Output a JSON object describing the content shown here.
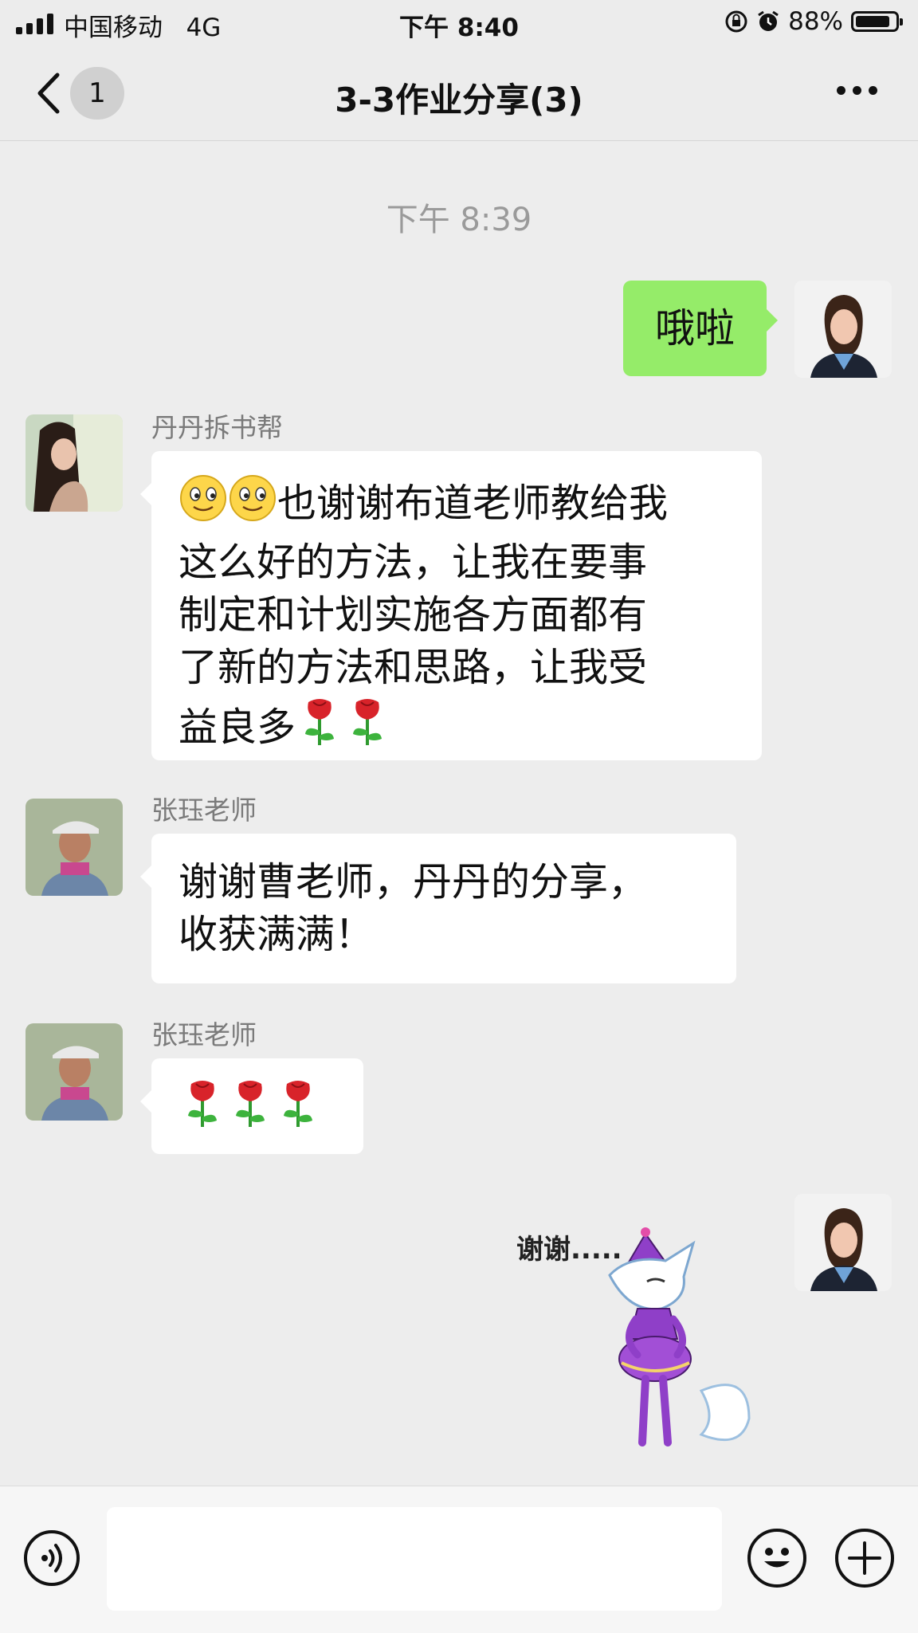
{
  "status_bar": {
    "carrier": "中国移动",
    "network": "4G",
    "time": "下午 8:40",
    "battery_text": "88%",
    "battery_level": 0.88
  },
  "nav": {
    "back_badge": "1",
    "title": "3-3作业分享(3)"
  },
  "chat": {
    "timestamp": "下午 8:39",
    "messages": [
      {
        "sender": "me",
        "text": "哦啦"
      },
      {
        "sender": "丹丹拆书帮",
        "lines": [
          "也谢谢布道老师教给我",
          "这么好的方法，让我在要事",
          "制定和计划实施各方面都有",
          "了新的方法和思路，让我受",
          "益良多"
        ]
      },
      {
        "sender": "张珏老师",
        "lines": [
          "谢谢曹老师，丹丹的分享，",
          "收获满满！"
        ]
      },
      {
        "sender": "张珏老师",
        "text": ""
      },
      {
        "sender": "me",
        "sticker_text": "谢谢....."
      }
    ]
  },
  "icons": {
    "back": "chevron-left-icon",
    "more": "more-icon",
    "voice": "voice-icon",
    "emoji": "emoji-icon",
    "add": "plus-icon",
    "smile": "smile-emoji-icon",
    "rose": "rose-emoji-icon"
  },
  "colors": {
    "sent_bubble": "#95ec69",
    "received_bubble": "#ffffff",
    "background": "#ededed"
  }
}
